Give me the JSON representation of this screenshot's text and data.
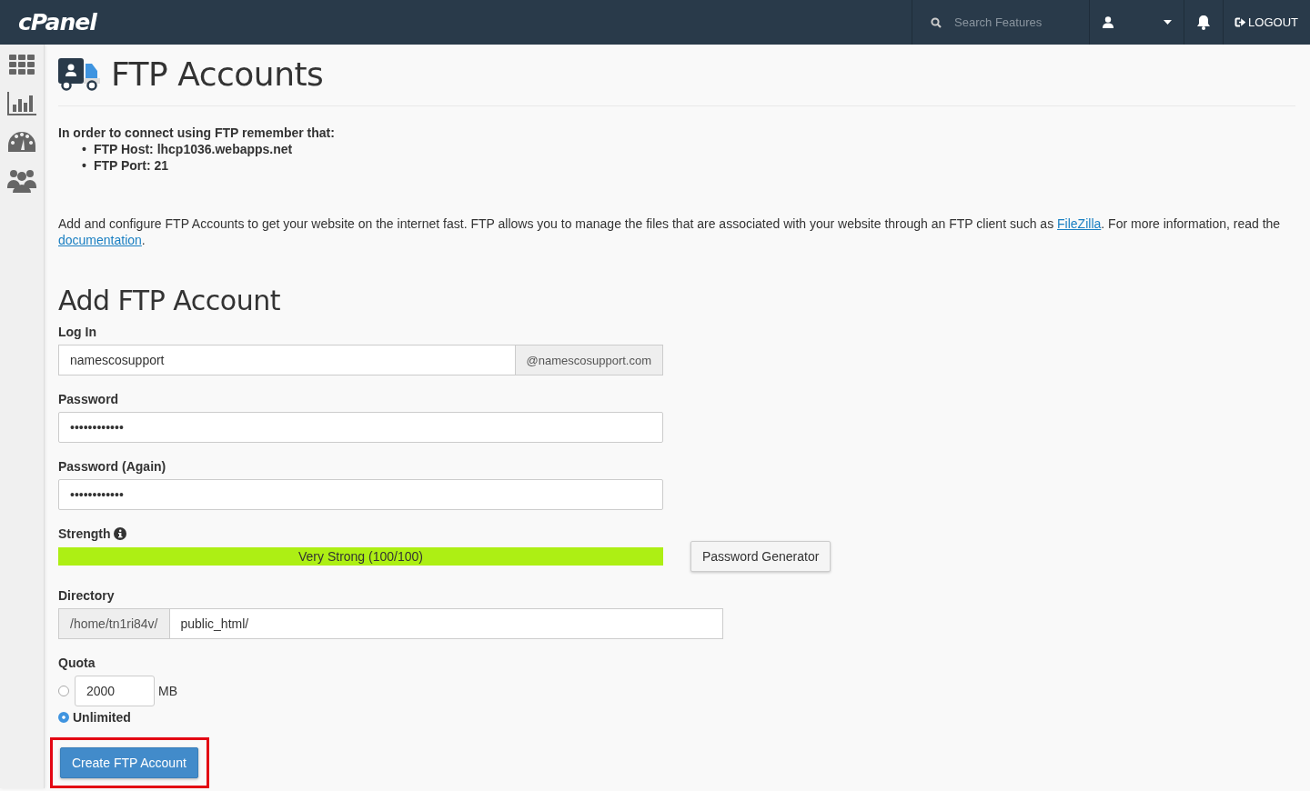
{
  "topbar": {
    "logo": "cPanel",
    "search": {
      "placeholder": "Search Features"
    },
    "logout": "LOGOUT"
  },
  "sidebar": {
    "items": [
      {
        "kind": "grid"
      },
      {
        "kind": "stats"
      },
      {
        "kind": "gauge"
      },
      {
        "kind": "users"
      }
    ]
  },
  "page": {
    "title": "FTP Accounts"
  },
  "notice": {
    "heading": "In order to connect using FTP remember that:",
    "items": [
      {
        "bullet": "•",
        "text": "FTP Host: lhcp1036.webapps.net"
      },
      {
        "bullet": "•",
        "text": "FTP Port: 21"
      }
    ]
  },
  "description": [
    {
      "kind": "text",
      "text": "Add and configure FTP Accounts to get your website on the internet fast. FTP allows you to manage the files that are associated with your website through an FTP client such as "
    },
    {
      "kind": "link",
      "text": "FileZilla"
    },
    {
      "kind": "text",
      "text": ". For more information, read the "
    },
    {
      "kind": "link",
      "text": "documentation"
    },
    {
      "kind": "text",
      "text": "."
    }
  ],
  "form": {
    "title": "Add FTP Account",
    "login": {
      "label": "Log In",
      "value": "namescosupport",
      "suffix": "@namescosupport.com"
    },
    "password": {
      "label": "Password",
      "value": "••••••••••••"
    },
    "password_again": {
      "label": "Password (Again)",
      "value": "••••••••••••"
    },
    "strength": {
      "label": "Strength",
      "level": 1.0,
      "reading": "Very Strong (100/100)",
      "color": "#adef14"
    },
    "generator_button": "Password Generator",
    "directory": {
      "label": "Directory",
      "prefix": "/home/tn1ri84v/",
      "value": "public_html/"
    },
    "quota": {
      "label": "Quota",
      "options": [
        {
          "kind": "limit",
          "value": "2000",
          "unit": "MB",
          "selected": false
        },
        {
          "kind": "unlimited",
          "text": "Unlimited",
          "selected": true
        }
      ]
    },
    "submit": {
      "text": "Create FTP Account",
      "highlighted": true
    }
  }
}
